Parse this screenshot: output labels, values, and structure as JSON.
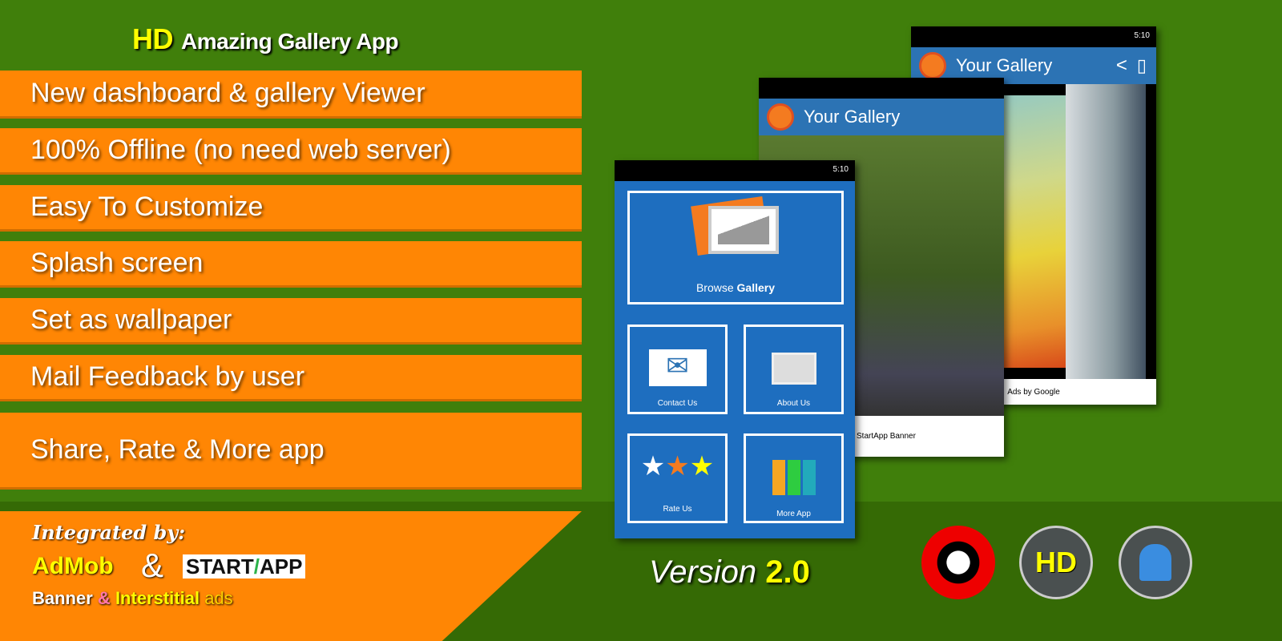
{
  "title": {
    "hd": "HD",
    "text": "Amazing Gallery App"
  },
  "features": [
    "New dashboard & gallery Viewer",
    "100% Offline (no need web server)",
    "Easy To Customize",
    "Splash screen",
    "Set as wallpaper",
    "Mail Feedback by user",
    "Share, Rate & More app"
  ],
  "integration": {
    "label": "Integrated by:",
    "admob": "AdMob",
    "amp": "&",
    "startapp_a": "START",
    "startapp_slash": "/",
    "startapp_b": "APP",
    "banner": "Banner",
    "and": "&",
    "interstitial": "Interstitial",
    "ads": "ads"
  },
  "phones": {
    "back": {
      "time": "5:10",
      "title": "Your Gallery",
      "footer": "Ads by Google"
    },
    "middle": {
      "title": "Your Gallery",
      "footer": "StartApp Banner"
    },
    "front": {
      "time": "5:10",
      "browse": "Browse",
      "gallery": "Gallery",
      "tiles": [
        "Contact Us",
        "About Us",
        "Rate Us",
        "More App"
      ]
    }
  },
  "version": {
    "label": "Version",
    "number": "2.0"
  },
  "badges": {
    "hd": "HD"
  },
  "colors": {
    "green": "#407f0b",
    "orange": "#ff8604",
    "blue": "#2c73b4",
    "yellow": "#ffff00"
  }
}
